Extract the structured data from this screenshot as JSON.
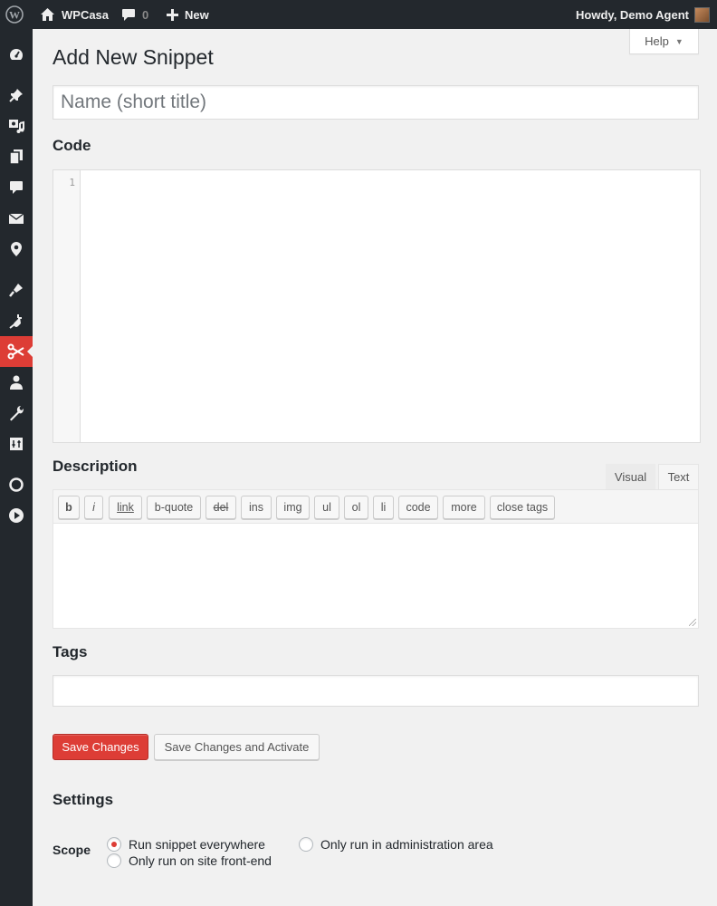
{
  "adminbar": {
    "site_name": "WPCasa",
    "comment_count": "0",
    "new_label": "New",
    "howdy": "Howdy, Demo Agent"
  },
  "sidebar": {
    "icons": [
      "dashboard-icon",
      "pin-icon",
      "media-icon",
      "pages-icon",
      "comments-icon",
      "mail-icon",
      "location-icon",
      "appearance-icon",
      "plugins-icon",
      "snippets-icon",
      "users-icon",
      "tools-icon",
      "settings-icon",
      "circle-icon",
      "play-icon"
    ],
    "active": "snippets-icon",
    "active_color": "#dd3d36"
  },
  "help": {
    "label": "Help"
  },
  "page": {
    "title": "Add New Snippet",
    "name_placeholder": "Name (short title)"
  },
  "code": {
    "heading": "Code",
    "line_numbers": [
      "1"
    ]
  },
  "description": {
    "heading": "Description",
    "tabs": [
      "Visual",
      "Text"
    ],
    "active_tab": "Text",
    "quicktags": [
      "b",
      "i",
      "link",
      "b-quote",
      "del",
      "ins",
      "img",
      "ul",
      "ol",
      "li",
      "code",
      "more",
      "close tags"
    ]
  },
  "tags": {
    "heading": "Tags"
  },
  "actions": {
    "save": "Save Changes",
    "save_activate": "Save Changes and Activate",
    "primary_color": "#dd3d36"
  },
  "settings": {
    "heading": "Settings",
    "scope_label": "Scope",
    "options": [
      "Run snippet everywhere",
      "Only run in administration area",
      "Only run on site front-end"
    ],
    "selected": "Run snippet everywhere"
  }
}
